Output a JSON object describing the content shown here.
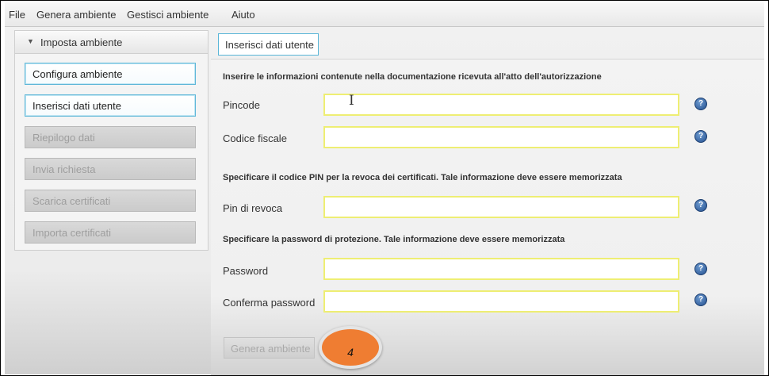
{
  "menu": {
    "items": [
      "File",
      "Genera ambiente",
      "Gestisci ambiente",
      "Aiuto"
    ]
  },
  "sidebar": {
    "header": "Imposta ambiente",
    "items": [
      {
        "label": "Configura ambiente",
        "state": "active"
      },
      {
        "label": "Inserisci dati utente",
        "state": "active"
      },
      {
        "label": "Riepilogo dati",
        "state": "disabled"
      },
      {
        "label": "Invia richiesta",
        "state": "disabled"
      },
      {
        "label": "Scarica certificati",
        "state": "disabled"
      },
      {
        "label": "Importa certificati",
        "state": "disabled"
      }
    ]
  },
  "tab": {
    "label": "Inserisci dati utente"
  },
  "form": {
    "section1": "Inserire le informazioni contenute nella documentazione ricevuta all'atto dell'autorizzazione",
    "section2": "Specificare il codice PIN per la revoca dei certificati. Tale informazione deve essere memorizzata",
    "section3": "Specificare la password di protezione. Tale informazione deve essere memorizzata",
    "fields": {
      "pincode": {
        "label": "Pincode",
        "value": ""
      },
      "codice_fiscale": {
        "label": "Codice fiscale",
        "value": ""
      },
      "pin_revoca": {
        "label": "Pin di revoca",
        "value": ""
      },
      "password": {
        "label": "Password",
        "value": ""
      },
      "conferma_password": {
        "label": "Conferma password",
        "value": ""
      }
    },
    "help_glyph": "?"
  },
  "actions": {
    "genera_label": "Genera ambiente"
  },
  "annotation": {
    "step": "4"
  },
  "colors": {
    "field_border": "#eeee73",
    "active_border": "#5fb7d8",
    "badge": "#ef7d32",
    "help_icon": "#24508f"
  }
}
